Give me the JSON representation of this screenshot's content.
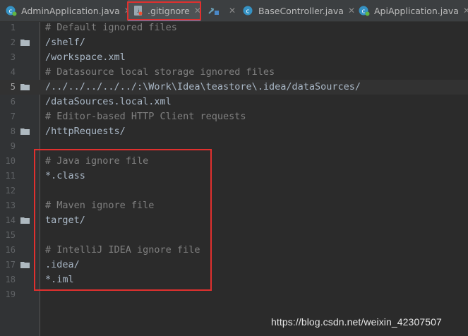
{
  "tabs": [
    {
      "label": "AdminApplication.java",
      "icon": "java-class-icon"
    },
    {
      "label": ".gitignore",
      "icon": "gitignore-file-icon",
      "active": true
    },
    {
      "label": "",
      "icon": "spring-config-icon"
    },
    {
      "label": "BaseController.java",
      "icon": "java-class-icon"
    },
    {
      "label": "ApiApplication.java",
      "icon": "java-class-icon"
    }
  ],
  "editor": {
    "lines": [
      {
        "num": "1",
        "text": "# Default ignored files",
        "type": "comment"
      },
      {
        "num": "2",
        "text": "/shelf/",
        "type": "plain"
      },
      {
        "num": "3",
        "text": "/workspace.xml",
        "type": "plain"
      },
      {
        "num": "4",
        "text": "# Datasource local storage ignored files",
        "type": "comment"
      },
      {
        "num": "5",
        "text": "/../../../../../:\\Work\\Idea\\teastore\\.idea/dataSources/",
        "type": "plain"
      },
      {
        "num": "6",
        "text": "/dataSources.local.xml",
        "type": "plain"
      },
      {
        "num": "7",
        "text": "# Editor-based HTTP Client requests",
        "type": "comment"
      },
      {
        "num": "8",
        "text": "/httpRequests/",
        "type": "plain"
      },
      {
        "num": "9",
        "text": "",
        "type": "plain"
      },
      {
        "num": "10",
        "text": "# Java ignore file",
        "type": "comment"
      },
      {
        "num": "11",
        "text": "*.class",
        "type": "plain"
      },
      {
        "num": "12",
        "text": "",
        "type": "plain"
      },
      {
        "num": "13",
        "text": "# Maven ignore file",
        "type": "comment"
      },
      {
        "num": "14",
        "text": "target/",
        "type": "plain"
      },
      {
        "num": "15",
        "text": "",
        "type": "plain"
      },
      {
        "num": "16",
        "text": "# IntelliJ IDEA ignore file",
        "type": "comment"
      },
      {
        "num": "17",
        "text": ".idea/",
        "type": "plain"
      },
      {
        "num": "18",
        "text": "*.iml",
        "type": "plain"
      },
      {
        "num": "19",
        "text": "",
        "type": "plain"
      }
    ],
    "current_line": "5",
    "folder_marker_lines": [
      "2",
      "5",
      "8",
      "14",
      "17"
    ]
  },
  "watermark": "https://blog.csdn.net/weixin_42307507",
  "colors": {
    "background": "#2b2b2b",
    "gutter": "#313335",
    "comment": "#808080",
    "text": "#a9b7c6",
    "highlight_box": "#e0302e",
    "active_tab_underline": "#4a88c7"
  }
}
